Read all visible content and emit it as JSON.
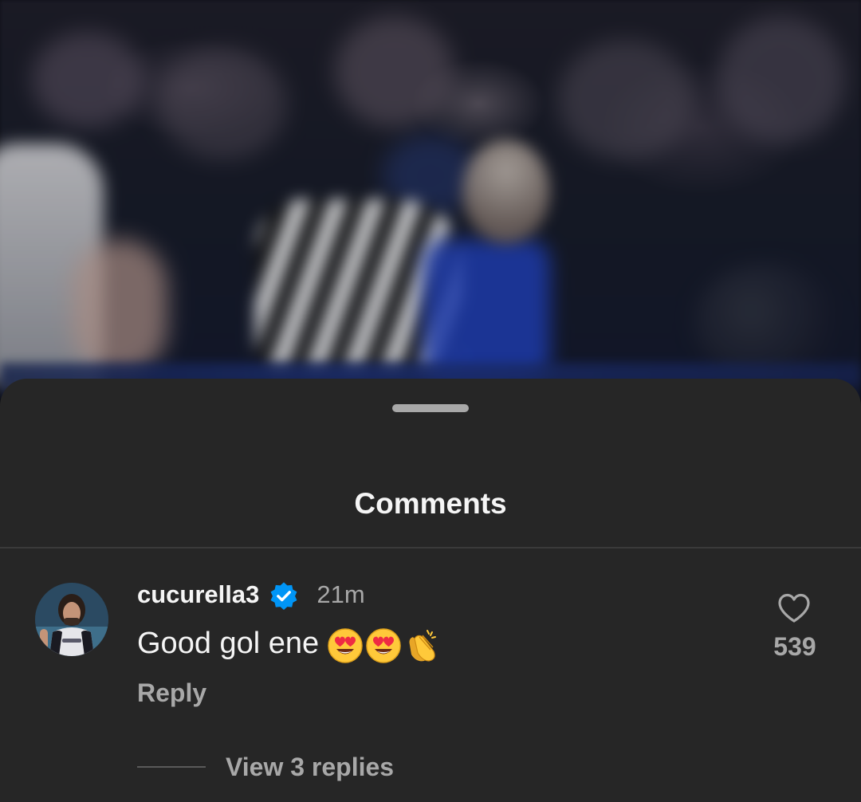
{
  "sheet": {
    "title": "Comments"
  },
  "comment": {
    "username": "cucurella3",
    "verified": true,
    "timestamp": "21m",
    "text": "Good gol ene",
    "emojis": [
      "heart-eyes-emoji",
      "heart-eyes-emoji",
      "clapping-hands-emoji"
    ],
    "reply_label": "Reply",
    "like_count": "539",
    "view_replies_label": "View 3 replies"
  },
  "colors": {
    "sheet_background": "#262626",
    "primary_text": "#f5f5f5",
    "secondary_text": "#a8a8a8",
    "verified_badge": "#0095f6"
  }
}
